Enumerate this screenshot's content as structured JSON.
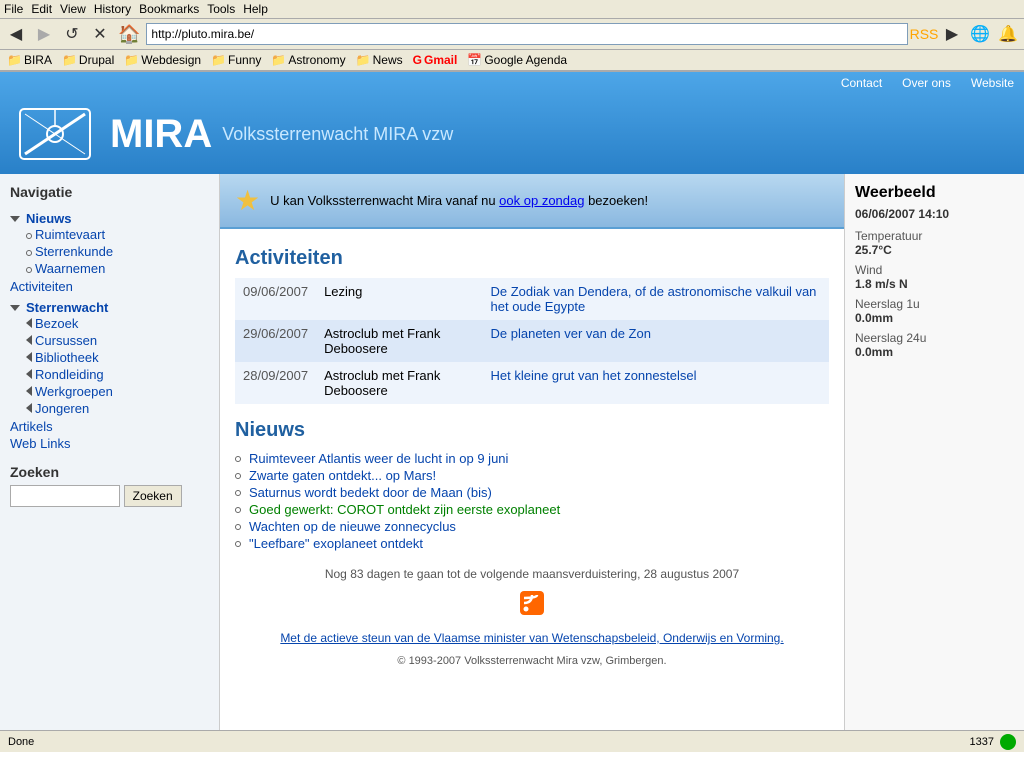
{
  "browser": {
    "menu_items": [
      "File",
      "Edit",
      "View",
      "History",
      "Bookmarks",
      "Tools",
      "Help"
    ],
    "url": "http://pluto.mira.be/",
    "back_btn": "◀",
    "forward_btn": "▶",
    "reload_btn": "↺",
    "stop_btn": "✕",
    "bookmarks": [
      {
        "label": "BIRA",
        "icon": "📁"
      },
      {
        "label": "Drupal",
        "icon": "📁"
      },
      {
        "label": "Webdesign",
        "icon": "📁"
      },
      {
        "label": "Funny",
        "icon": "📁"
      },
      {
        "label": "Astronomy",
        "icon": "📁"
      },
      {
        "label": "News",
        "icon": "📁"
      },
      {
        "label": "Gmail",
        "icon": "G"
      },
      {
        "label": "Google Agenda",
        "icon": "📅"
      }
    ]
  },
  "header": {
    "nav_links": [
      "Contact",
      "Over ons",
      "Website"
    ],
    "logo_alt": "MIRA logo",
    "site_name": "MIRA",
    "site_subtitle": "Volkssterrenwacht MIRA vzw"
  },
  "announcement": {
    "text": "U kan Volkssterrenwacht Mira vanaf nu ",
    "link_text": "ook op zondag",
    "text_after": " bezoeken!"
  },
  "sidebar": {
    "nav_title": "Navigatie",
    "items": [
      {
        "label": "Nieuws",
        "type": "link-open",
        "children": [
          "Ruimtevaart",
          "Sterrenkunde",
          "Waarnemen"
        ]
      },
      {
        "label": "Activiteiten",
        "type": "link"
      },
      {
        "label": "Sterrenwacht",
        "type": "link-open",
        "children": [
          "Bezoek",
          "Cursussen",
          "Bibliotheek",
          "Rondleiding",
          "Werkgroepen",
          "Jongeren"
        ]
      },
      {
        "label": "Artikels",
        "type": "link"
      },
      {
        "label": "Web Links",
        "type": "link"
      }
    ],
    "search_title": "Zoeken",
    "search_placeholder": "",
    "search_btn_label": "Zoeken"
  },
  "activities": {
    "section_title": "Activiteiten",
    "rows": [
      {
        "date": "09/06/2007",
        "type": "Lezing",
        "link_text": "De Zodiak van Dendera, of de astronomische valkuil van het oude Egypte"
      },
      {
        "date": "29/06/2007",
        "type": "Astroclub met Frank Deboosere",
        "link_text": "De planeten ver van de Zon"
      },
      {
        "date": "28/09/2007",
        "type": "Astroclub met Frank Deboosere",
        "link_text": "Het kleine grut van het zonnestelsel"
      }
    ]
  },
  "nieuws": {
    "section_title": "Nieuws",
    "items": [
      {
        "text": "Ruimteveer Atlantis weer de lucht in op 9 juni",
        "highlighted": false
      },
      {
        "text": "Zwarte gaten ontdekt... op Mars!",
        "highlighted": false
      },
      {
        "text": "Saturnus wordt bedekt door de Maan (bis)",
        "highlighted": false
      },
      {
        "text": "Goed gewerkt: COROT ontdekt zijn eerste exoplaneet",
        "highlighted": true
      },
      {
        "text": "Wachten op de nieuwe zonnecyclus",
        "highlighted": false
      },
      {
        "text": "\"Leefbare\" exoplaneet ontdekt",
        "highlighted": false
      }
    ],
    "countdown": "Nog 83 dagen te gaan tot de volgende maansverduistering, 28 augustus 2007",
    "footer_support": "Met de actieve steun van de Vlaamse minister van Wetenschapsbeleid, Onderwijs en Vorming.",
    "copyright": "© 1993-2007 Volkssterrenwacht Mira vzw, Grimbergen."
  },
  "weather": {
    "title": "Weerbeeld",
    "date": "06/06/2007 14:10",
    "rows": [
      {
        "label": "Temperatuur",
        "value": "25.7°C"
      },
      {
        "label": "Wind",
        "value": "1.8 m/s N"
      },
      {
        "label": "Neerslag 1u",
        "value": "0.0mm"
      },
      {
        "label": "Neerslag 24u",
        "value": "0.0mm"
      }
    ]
  },
  "status_bar": {
    "status_text": "Done",
    "page_count": "1337"
  }
}
